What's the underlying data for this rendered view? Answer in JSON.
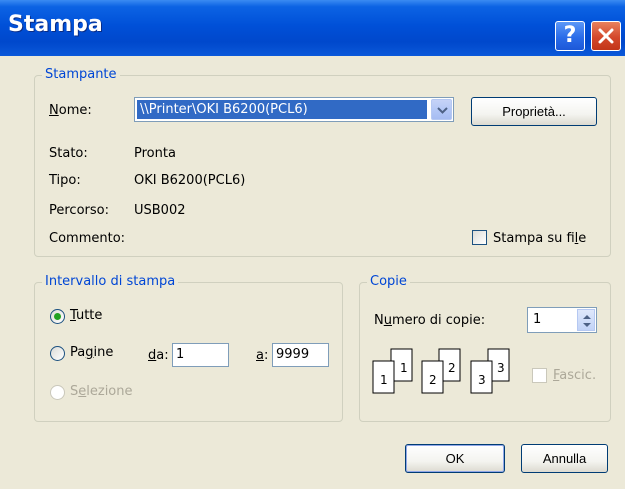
{
  "window": {
    "title": "Stampa"
  },
  "titlebar_buttons": {
    "help_icon": "help-icon",
    "close_icon": "close-icon",
    "help_glyph": "?"
  },
  "printer": {
    "legend": "Stampante",
    "name_label": "Nome:",
    "name_value": "\\\\Printer\\OKI B6200(PCL6)",
    "properties_button": "Proprietà...",
    "status_label": "Stato:",
    "status_value": "Pronta",
    "type_label": "Tipo:",
    "type_value": "OKI B6200(PCL6)",
    "path_label": "Percorso:",
    "path_value": "USB002",
    "comment_label": "Commento:",
    "print_to_file_label": "Stampa su file",
    "print_to_file_checked": false
  },
  "range": {
    "legend": "Intervallo di stampa",
    "all_label": "Tutte",
    "all_selected": true,
    "pages_label": "Pagine",
    "from_label": "da:",
    "from_value": "1",
    "to_label": "a:",
    "to_value": "9999",
    "selection_label": "Selezione",
    "selection_enabled": false
  },
  "copies": {
    "legend": "Copie",
    "count_label": "Numero di copie:",
    "count_value": "1",
    "collate_label": "Fascic.",
    "collate_enabled": false,
    "collate_pages": [
      "1",
      "1",
      "2",
      "2",
      "3",
      "3"
    ]
  },
  "footer": {
    "ok_button": "OK",
    "cancel_button": "Annulla"
  },
  "colors": {
    "title_bar": "#0050d8",
    "group_legend": "#0046d5",
    "selection": "#316ac5",
    "dialog_bg": "#ece9d8"
  }
}
